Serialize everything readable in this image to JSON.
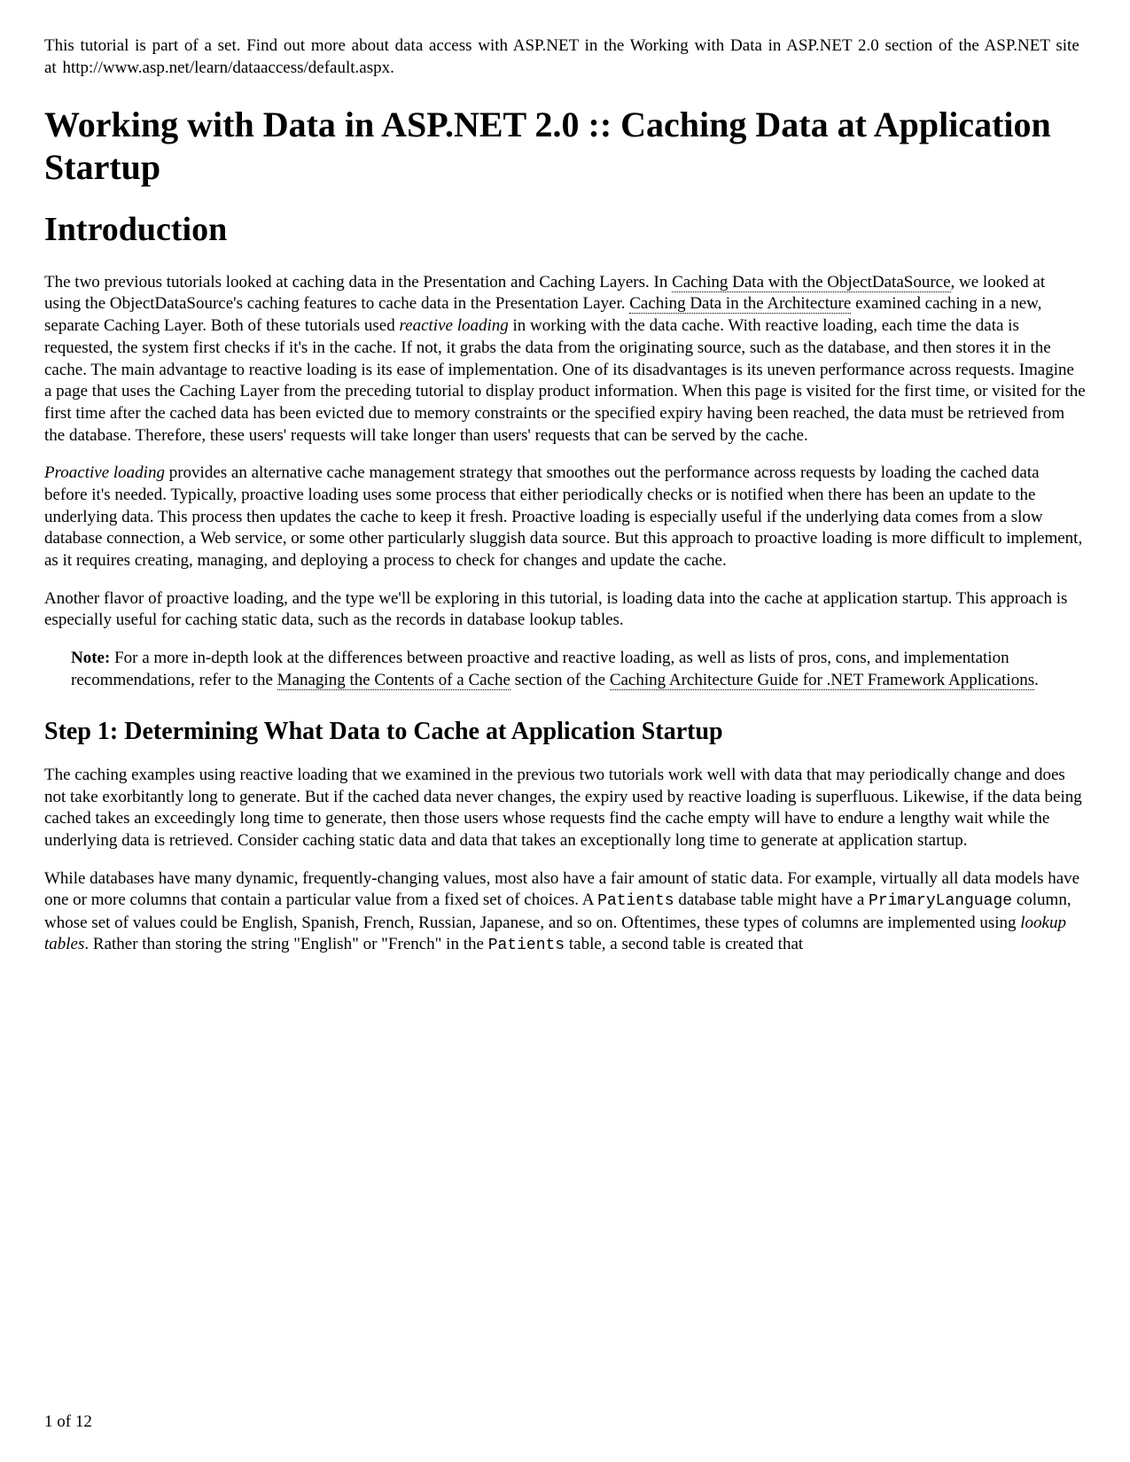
{
  "header_note_prefix": "This tutorial is part of a set. Find out more about data access with ASP.NET in the Working with Data in  ASP.NET 2.0 section of the ASP.NET site at http://www.asp.net/learn/dataaccess/default.aspx.",
  "title": "Working with Data in ASP.NET 2.0 :: Caching Data at Application Startup",
  "intro_heading": "Introduction",
  "p1_seg1": "The two previous tutorials looked at caching data in the Presentation and Caching Layers. In ",
  "p1_link1": "Caching Data with the ObjectDataSource",
  "p1_seg2": ", we looked at using the ObjectDataSource's caching features to cache data in the Presentation Layer. ",
  "p1_link2": "Caching Data in the Architecture",
  "p1_seg3": " examined caching in a new, separate Caching Layer. Both of these tutorials used ",
  "p1_em1": "reactive loading",
  "p1_seg4": " in working with the data cache. With reactive loading, each time the data is requested, the system first checks if it's in the cache. If not, it grabs the data from the originating source, such as the database, and then stores it in the cache. The main advantage to reactive loading is its ease of implementation. One of its disadvantages is its uneven performance across requests. Imagine a page that uses the Caching Layer from the preceding tutorial to display product information. When this page is visited for the first time, or visited for the first time after the cached data has been evicted due to memory constraints or the specified expiry having been reached, the data must be retrieved from the database. Therefore, these users' requests will take longer than users' requests that can be served by the cache.",
  "p2_em1": "Proactive loading",
  "p2_seg1": " provides an alternative cache management strategy that smoothes out the performance across requests by loading the cached data before it's needed. Typically, proactive loading uses some process that either periodically checks or is notified when there has been an update to the underlying data. This process then updates the cache to keep it fresh. Proactive loading is especially useful if the underlying data comes from a slow database connection, a Web service, or some other particularly sluggish data source. But this approach to proactive loading is more difficult to implement, as it requires creating, managing, and deploying a process to check for changes and update the cache.",
  "p3": "Another flavor of proactive loading, and the type we'll be exploring in this tutorial, is loading data into the cache at application startup. This approach is especially useful for caching static data, such as the records in database lookup tables.",
  "note_label": "Note:",
  "note_seg1": " For a more in-depth look at the differences between proactive and reactive loading, as well as lists of pros, cons, and implementation recommendations, refer to the ",
  "note_link1": "Managing the Contents of a Cache",
  "note_seg2": " section of the ",
  "note_link2": "Caching Architecture Guide for .NET Framework Applications",
  "note_seg3": ".",
  "step1_heading": "Step 1: Determining What Data to Cache at Application Startup",
  "p4": "The caching examples using reactive loading that we examined in the previous two tutorials work well with data that may periodically change and does not take exorbitantly long to generate. But if the cached data never changes, the expiry used by reactive loading is superfluous. Likewise, if the data being cached takes an exceedingly long time to generate, then those users whose requests find the cache empty will have to endure a lengthy wait while the underlying data is retrieved. Consider caching static data and data that takes an exceptionally long time to generate at application startup.",
  "p5_seg1": "While databases have many dynamic, frequently-changing values, most also have a fair amount of static data. For example, virtually all data models have one or more columns that contain a particular value from a fixed set of choices. A ",
  "p5_code1": "Patients",
  "p5_seg2": " database table might have a ",
  "p5_code2": "PrimaryLanguage",
  "p5_seg3": " column, whose set of values could be English, Spanish, French, Russian, Japanese, and so on. Oftentimes, these types of columns are implemented using ",
  "p5_em1": "lookup tables",
  "p5_seg4": ". Rather than storing the string \"English\" or \"French\" in the ",
  "p5_code3": "Patients",
  "p5_seg5": " table, a second table is created that",
  "page_number": "1 of 12"
}
